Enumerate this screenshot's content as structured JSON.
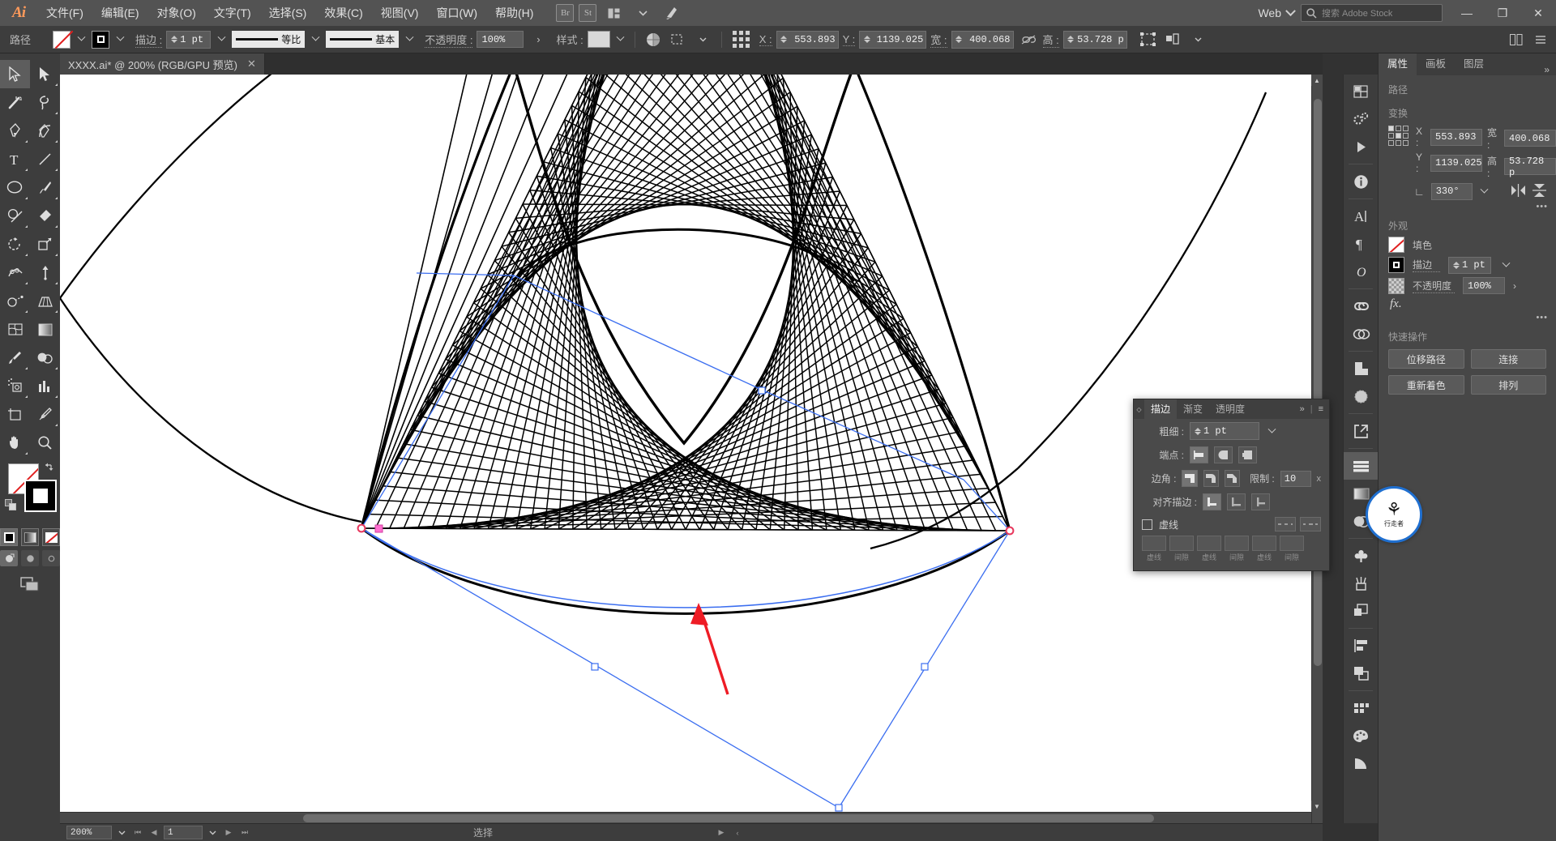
{
  "app": {
    "name": "Adobe Illustrator",
    "logo": "Ai"
  },
  "menubar": {
    "items": [
      "文件(F)",
      "编辑(E)",
      "对象(O)",
      "文字(T)",
      "选择(S)",
      "效果(C)",
      "视图(V)",
      "窗口(W)",
      "帮助(H)"
    ],
    "bridge_label": "Br",
    "stock_label": "St",
    "arrange_label": "arrange-docs",
    "workspace_switcher": "Web",
    "search_placeholder": "搜索 Adobe Stock",
    "window_buttons": {
      "minimize": "—",
      "maximize": "❐",
      "close": "✕"
    }
  },
  "control_bar": {
    "object_type": "路径",
    "fill_label": "fill-none",
    "stroke_swatch_label": "stroke-black",
    "stroke_label": "描边 :",
    "stroke_weight": "1 pt",
    "variable_width_profile": "等比",
    "brush_definition": "基本",
    "opacity_label": "不透明度 :",
    "opacity_value": "100%",
    "style_label": "样式 :",
    "x_label": "X :",
    "x_value": "553.893",
    "y_label": "Y :",
    "y_value": "1139.025",
    "w_label": "宽 :",
    "w_value": "400.068",
    "h_label": "高 :",
    "h_value": "53.728 p"
  },
  "document_tab": {
    "title": "XXXX.ai* @ 200% (RGB/GPU 预览)",
    "close": "✕"
  },
  "toolbar": {
    "tools": [
      {
        "name": "selection-tool",
        "selected": true
      },
      {
        "name": "direct-selection-tool",
        "selected": false
      },
      {
        "name": "magic-wand-tool",
        "selected": false
      },
      {
        "name": "lasso-tool",
        "selected": false
      },
      {
        "name": "pen-tool",
        "selected": false
      },
      {
        "name": "curvature-tool",
        "selected": false
      },
      {
        "name": "type-tool",
        "selected": false
      },
      {
        "name": "line-segment-tool",
        "selected": false
      },
      {
        "name": "ellipse-tool",
        "selected": false
      },
      {
        "name": "paintbrush-tool",
        "selected": false
      },
      {
        "name": "shaper-tool",
        "selected": false
      },
      {
        "name": "eraser-tool",
        "selected": false
      },
      {
        "name": "rotate-tool",
        "selected": false
      },
      {
        "name": "scale-tool",
        "selected": false
      },
      {
        "name": "width-tool",
        "selected": false
      },
      {
        "name": "free-transform-tool",
        "selected": false
      },
      {
        "name": "shape-builder-tool",
        "selected": false
      },
      {
        "name": "perspective-grid-tool",
        "selected": false
      },
      {
        "name": "mesh-tool",
        "selected": false
      },
      {
        "name": "gradient-tool",
        "selected": false
      },
      {
        "name": "eyedropper-tool",
        "selected": false
      },
      {
        "name": "blend-tool",
        "selected": false
      },
      {
        "name": "symbol-sprayer-tool",
        "selected": false
      },
      {
        "name": "column-graph-tool",
        "selected": false
      },
      {
        "name": "artboard-tool",
        "selected": false
      },
      {
        "name": "slice-tool",
        "selected": false
      },
      {
        "name": "hand-tool",
        "selected": false
      },
      {
        "name": "zoom-tool",
        "selected": false
      }
    ],
    "fill_state": "none",
    "stroke_state": "black",
    "color_modes": [
      "color",
      "gradient",
      "none"
    ],
    "draw_modes": [
      "draw-normal",
      "draw-behind",
      "draw-inside"
    ],
    "screen_mode": "change-screen-mode"
  },
  "properties_panel": {
    "tabs": [
      {
        "label": "属性",
        "active": true
      },
      {
        "label": "画板",
        "active": false
      },
      {
        "label": "图层",
        "active": false
      }
    ],
    "object_type": "路径",
    "transform": {
      "title": "变换",
      "x_label": "X :",
      "x_value": "553.893",
      "y_label": "Y :",
      "y_value": "1139.025",
      "w_label": "宽 :",
      "w_value": "400.068",
      "h_label": "高 :",
      "h_value": "53.728 p",
      "angle_value": "330°",
      "flip_h": "flip-horizontal",
      "flip_v": "flip-vertical",
      "link_label": "constrain-proportions-off"
    },
    "appearance": {
      "title": "外观",
      "fill_label": "填色",
      "stroke_label": "描边",
      "stroke_weight": "1 pt",
      "opacity_label": "不透明度",
      "opacity_value": "100%",
      "fx_label": "fx."
    },
    "quick_actions": {
      "title": "快速操作",
      "buttons": [
        "位移路径",
        "连接",
        "重新着色",
        "排列"
      ]
    }
  },
  "stroke_panel": {
    "tabs": [
      {
        "label": "描边",
        "active": true
      },
      {
        "label": "渐变",
        "active": false
      },
      {
        "label": "透明度",
        "active": false
      }
    ],
    "weight_label": "粗细 :",
    "weight_value": "1 pt",
    "cap_label": "端点 :",
    "corner_label": "边角 :",
    "limit_label": "限制 :",
    "limit_value": "10",
    "limit_unit": "x",
    "align_label": "对齐描边 :",
    "dashed_label": "虚线",
    "dash_labels": [
      "虚线",
      "间隙",
      "虚线",
      "间隙",
      "虚线",
      "间隙"
    ],
    "collapse_icon": "»",
    "menu_icon": "≡"
  },
  "status_bar": {
    "zoom": "200%",
    "page": "1",
    "status_text": "选择",
    "first_icon": "first-page",
    "prev_icon": "prev-page",
    "next_icon": "next-page",
    "last_icon": "last-page"
  },
  "icon_dock": {
    "icons": [
      "artboards-icon",
      "actions-icon",
      "play-icon",
      "info-icon",
      "character-icon",
      "paragraph-icon",
      "glyphs-icon",
      "links-icon",
      "symbols-icon",
      "image-trace-icon",
      "transparency-icon",
      "export-icon",
      "align-icon",
      "gradient-icon",
      "appearance-icon",
      "brushes-icon",
      "artboard-panel-icon",
      "pathfinder-icon",
      "layers-panel-icon",
      "swatches-icon",
      "color-icon",
      "color-guide-icon"
    ]
  },
  "watermark": {
    "glyph": "⚘",
    "text": "行走者"
  },
  "canvas": {
    "zoom_level": "200%",
    "annotation_arrow": "red-arrow-annotation",
    "selection_color": "#3b6ef0",
    "anchor_color": "#e8385e"
  }
}
